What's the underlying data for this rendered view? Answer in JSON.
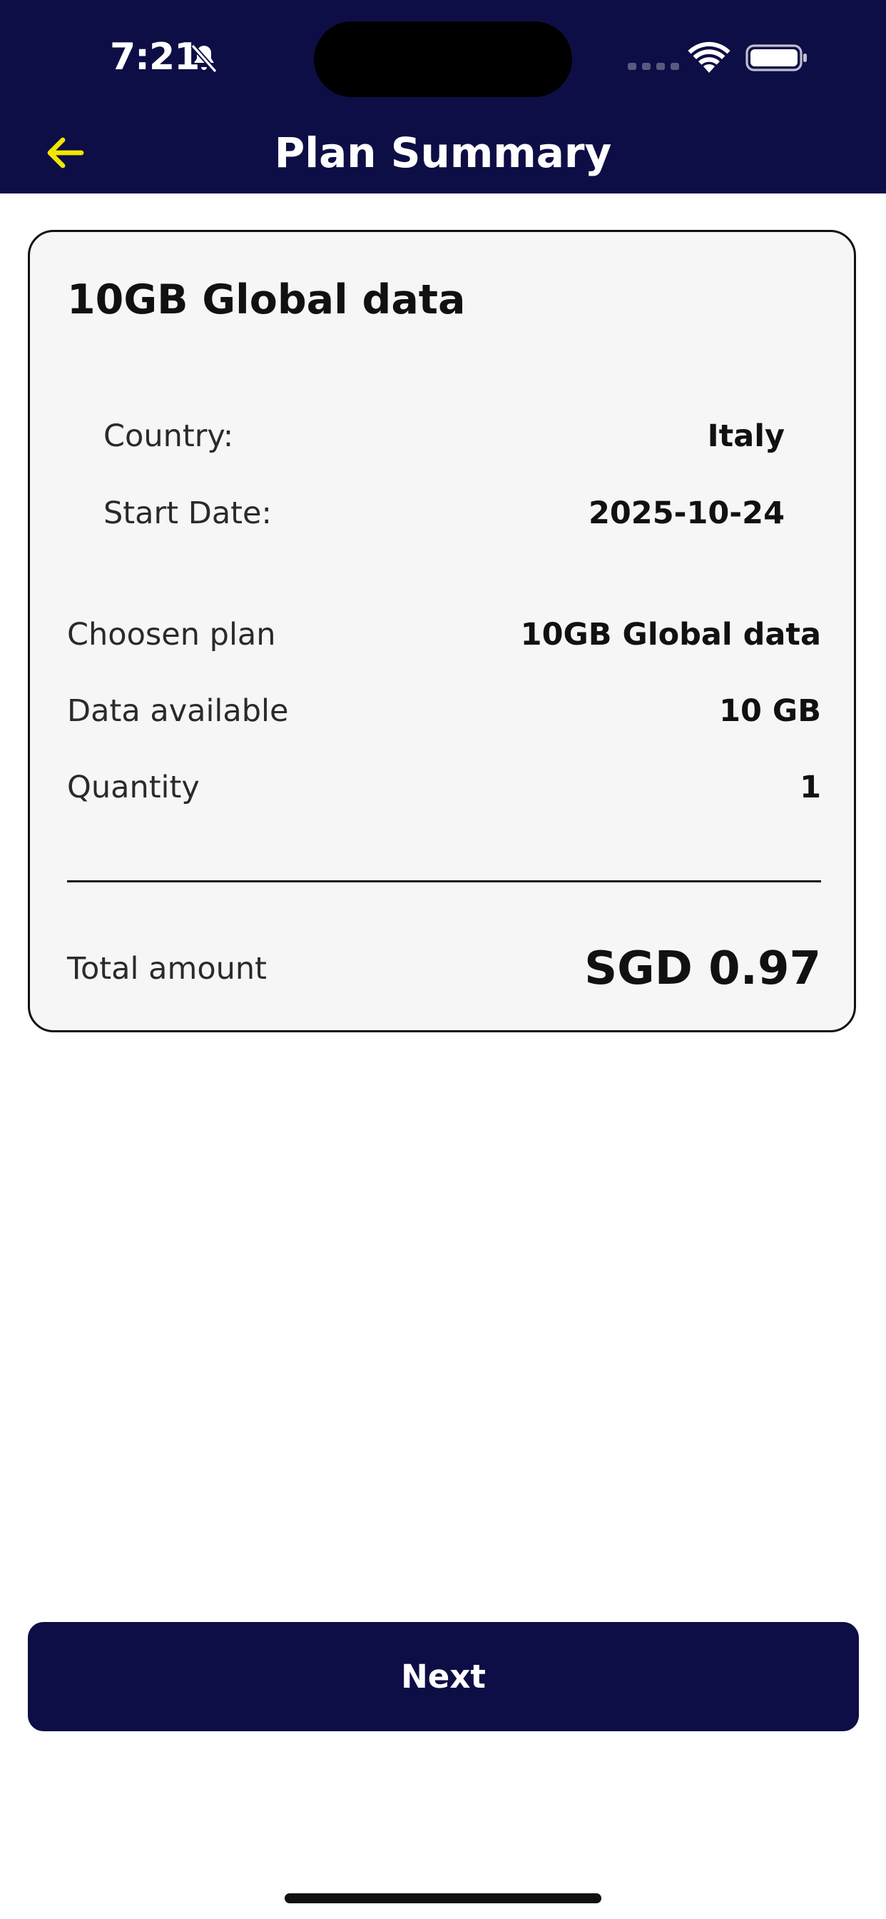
{
  "status_bar": {
    "time": "7:21",
    "icons": [
      "bell-off-icon",
      "cellular-signal-icon",
      "wifi-icon",
      "battery-icon"
    ]
  },
  "nav": {
    "title": "Plan Summary",
    "back_icon": "arrow-left-icon"
  },
  "summary": {
    "plan_title": "10GB Global data",
    "details": [
      {
        "label": "Country:",
        "value": "Italy"
      },
      {
        "label": "Start Date:",
        "value": "2025-10-24"
      }
    ],
    "rows": [
      {
        "label": "Choosen plan",
        "value": "10GB Global data"
      },
      {
        "label": "Data available",
        "value": "10 GB"
      },
      {
        "label": "Quantity",
        "value": "1"
      }
    ],
    "total": {
      "label": "Total amount",
      "value": "SGD 0.97"
    }
  },
  "actions": {
    "next_label": "Next"
  },
  "colors": {
    "header_bg": "#0e0e46",
    "accent": "#f2e600",
    "card_bg": "#f6f6f6",
    "button_bg": "#0e0e46"
  }
}
